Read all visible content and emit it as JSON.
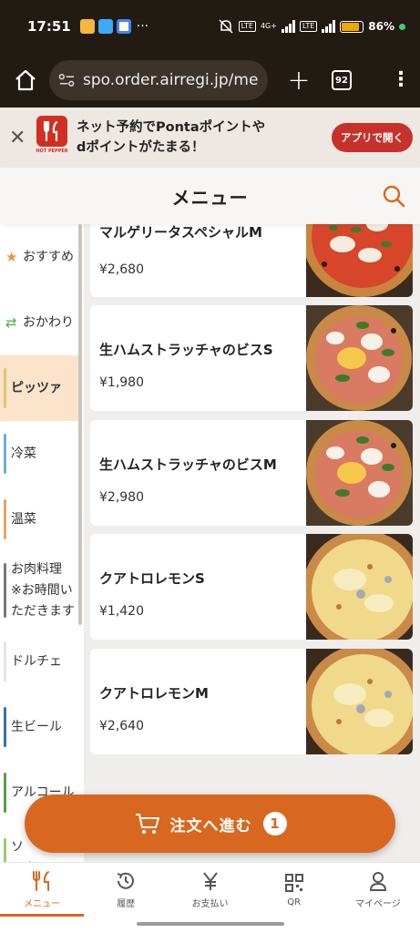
{
  "status_bar": {
    "time": "17:51",
    "more": "···",
    "network": "4G+",
    "lte": "LTE",
    "lte2": "LTE",
    "battery": "86%",
    "battery_level": 0.86
  },
  "browser": {
    "url": "spo.order.airregi.jp/men",
    "tab_count": "92"
  },
  "promo": {
    "logo_text": "HOT PEPPER",
    "line1": "ネット予約でPontaポイントや",
    "line2": "dポイントがたまる！",
    "button": "アプリで開く"
  },
  "header": {
    "title": "メニュー"
  },
  "categories": [
    {
      "label": "おすすめ",
      "icon": "star-icon",
      "color": "#e79a3c"
    },
    {
      "label": "おかわり",
      "icon": "refresh-icon",
      "color": "#4caf50"
    },
    {
      "label": "ピッツァ",
      "color": "#e8c46a",
      "active": true
    },
    {
      "label": "冷菜",
      "color": "#6aaed6"
    },
    {
      "label": "温菜",
      "color": "#e2a46a"
    },
    {
      "label": "お肉料理",
      "line2": "※お時間い",
      "line3": "ただきます",
      "color": "#777777"
    },
    {
      "label": "ドルチェ",
      "color": "#e8e4e0"
    },
    {
      "label": "生ビール",
      "color": "#3a6ea8"
    },
    {
      "label": "アルコール",
      "color": "#5a9e48"
    },
    {
      "label": "ソ",
      "line2": "ンク",
      "color": "#9acb6a"
    }
  ],
  "items": [
    {
      "name": "マルゲリータスペシャルM",
      "price": "¥2,680",
      "image": "pizza-margherita"
    },
    {
      "name": "生ハムストラッチャのビスS",
      "price": "¥1,980",
      "image": "pizza-prosciutto"
    },
    {
      "name": "生ハムストラッチャのビスM",
      "price": "¥2,980",
      "image": "pizza-prosciutto"
    },
    {
      "name": "クアトロレモンS",
      "price": "¥1,420",
      "image": "pizza-quattro"
    },
    {
      "name": "クアトロレモンM",
      "price": "¥2,640",
      "image": "pizza-quattro"
    }
  ],
  "order_button": {
    "label": "注文へ進む",
    "count": "1"
  },
  "bottom_nav": [
    {
      "label": "メニュー",
      "icon": "fork-knife-icon",
      "active": true
    },
    {
      "label": "履歴",
      "icon": "history-icon"
    },
    {
      "label": "お支払い",
      "icon": "yen-icon"
    },
    {
      "label": "QR",
      "icon": "qr-icon"
    },
    {
      "label": "マイページ",
      "icon": "user-icon"
    }
  ],
  "colors": {
    "accent": "#d8681f",
    "header_dark": "#221b14",
    "promo_red": "#c8312b"
  }
}
